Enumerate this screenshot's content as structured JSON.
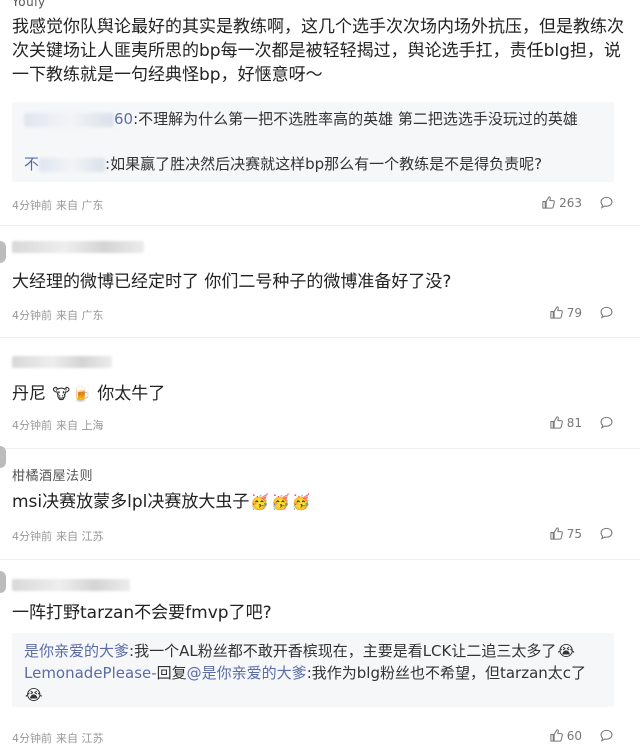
{
  "comments": [
    {
      "username": "Youly",
      "text": "我感觉你队舆论最好的其实是教练啊，这几个选手次次场内场外抗压，但是教练次次关键场让人匪夷所思的bp每一次都是被轻轻揭过，舆论选手扛，责任blg担，说一下教练就是一句经典怪bp，好惬意呀～",
      "replies": [
        {
          "name_suffix": "60",
          "text": "不理解为什么第一把不选胜率高的英雄 第二把选选手没玩过的英雄"
        },
        {
          "name_prefix": "不",
          "text": "如果赢了胜决然后决赛就这样bp那么有一个教练是不是得负责呢?"
        }
      ],
      "time": "4分钟前",
      "from": "来自 广东",
      "likes": "263"
    },
    {
      "text": "大经理的微博已经定时了 你们二号种子的微博准备好了没?",
      "time": "4分钟前",
      "from": "来自 广东",
      "likes": "79"
    },
    {
      "text": "丹尼",
      "text_tail": "你太牛了",
      "emojis": [
        "🐮",
        "🍺"
      ],
      "time": "4分钟前",
      "from": "来自 上海",
      "likes": "81"
    },
    {
      "username": "柑橘酒屋法则",
      "text": "msi决赛放蒙多lpl决赛放大虫子",
      "emojis": [
        "🥳",
        "🥳",
        "🥳"
      ],
      "time": "4分钟前",
      "from": "来自 江苏",
      "likes": "75"
    },
    {
      "text": "一阵打野tarzan不会要fmvp了吧?",
      "replies": [
        {
          "name": "是你亲爱的大爹",
          "text": "我一个AL粉丝都不敢开香槟现在，主要是看LCK让二追三太多了",
          "emoji": "😭"
        },
        {
          "name": "LemonadePlease-",
          "reply_word": "回复",
          "mention": "@是你亲爱的大爹",
          "text": "我作为blg粉丝也不希望，但tarzan太c了",
          "emoji": "😭"
        }
      ],
      "time": "4分钟前",
      "from": "来自 江苏",
      "likes": "60"
    }
  ],
  "icons": {
    "like": "thumbs-up-icon",
    "comment": "comment-bubble-icon"
  },
  "colors": {
    "reply_name": "#5a6ca8",
    "meta": "#999999",
    "reply_bg": "#f6f7f9"
  }
}
